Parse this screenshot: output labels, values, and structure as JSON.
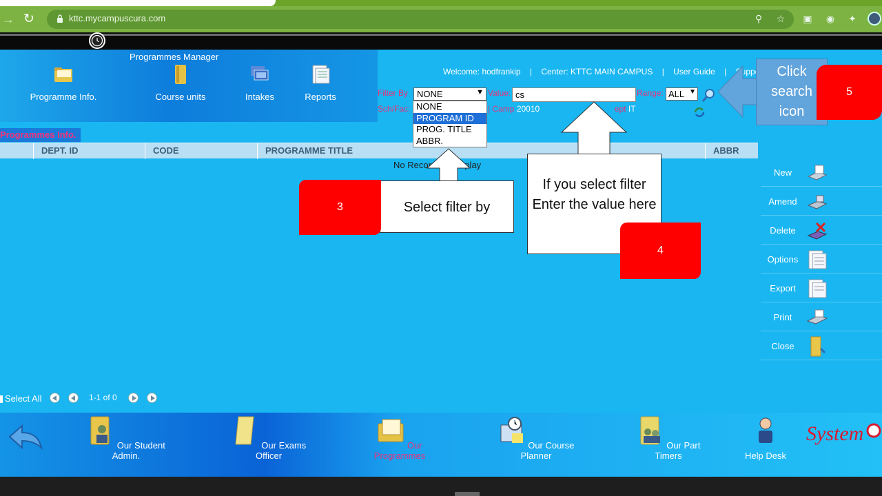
{
  "browser": {
    "url": "kttc.mycampuscura.com"
  },
  "app": {
    "page_heading": "Programmes Manager",
    "nav": [
      {
        "label": "Programme Info.",
        "icon": "folder-icon"
      },
      {
        "label": "Course units",
        "icon": "binder-icon"
      },
      {
        "label": "Intakes",
        "icon": "intakes-icon"
      },
      {
        "label": "Reports",
        "icon": "reports-icon"
      }
    ],
    "welcome": {
      "user": "Welcome: hodfrankip",
      "center": "Center: KTTC MAIN CAMPUS",
      "guide": "User Guide",
      "support": "Support",
      "sep": "|"
    },
    "filter": {
      "filter_by_label": "Filter By",
      "filter_by_value": "NONE",
      "value_label": "Value:",
      "value": "cs",
      "range_label": "Range:",
      "range_value": "ALL",
      "options": [
        "NONE",
        "PROGRAM ID",
        "PROG. TITLE",
        "ABBR."
      ],
      "selected_option": "PROGRAM ID",
      "sch_label": "Sch/Fac:",
      "camp_label": "| Camp",
      "camp_value": "20010",
      "dept_label": "ept",
      "dept_value": "IT"
    },
    "list_label": "Programmes Info.",
    "columns": [
      "DEPT. ID",
      "CODE",
      "PROGRAMME TITLE",
      "ABBR"
    ],
    "no_records": "No Records to display",
    "actions": [
      {
        "label": "New",
        "icon": "new-record-icon"
      },
      {
        "label": "Amend",
        "icon": "amend-icon"
      },
      {
        "label": "Delete",
        "icon": "delete-icon"
      },
      {
        "label": "Options",
        "icon": "options-icon"
      },
      {
        "label": "Export",
        "icon": "export-icon"
      },
      {
        "label": "Print",
        "icon": "printer-icon"
      },
      {
        "label": "Close",
        "icon": "close-folder-icon"
      }
    ],
    "pager": {
      "select_all": "Select All",
      "range_text": "1-1 of 0"
    },
    "dock": [
      {
        "label": "Our Student Admin.",
        "icon": "student-admin-icon",
        "active": false
      },
      {
        "label": "Our Exams Officer",
        "icon": "exams-officer-icon",
        "active": false
      },
      {
        "label": "Our Programmes",
        "icon": "programmes-icon",
        "active": true
      },
      {
        "label": "Our Course Planner",
        "icon": "course-planner-icon",
        "active": false
      },
      {
        "label": "Our Part Timers",
        "icon": "part-timers-icon",
        "active": false
      },
      {
        "label": "Help Desk",
        "icon": "help-desk-icon",
        "active": false
      }
    ],
    "logo_text": "System"
  },
  "annotations": {
    "step3": {
      "badge": "3",
      "text": "Select filter by"
    },
    "step4": {
      "badge": "4",
      "text": "If you select filter Enter the value here"
    },
    "step5": {
      "badge": "5",
      "text": "Click search icon"
    }
  },
  "colors": {
    "app_bg": "#19b6f1",
    "accent_pink": "#e7327a",
    "browser_green": "#7cb342",
    "badge_red": "#ff0000"
  }
}
